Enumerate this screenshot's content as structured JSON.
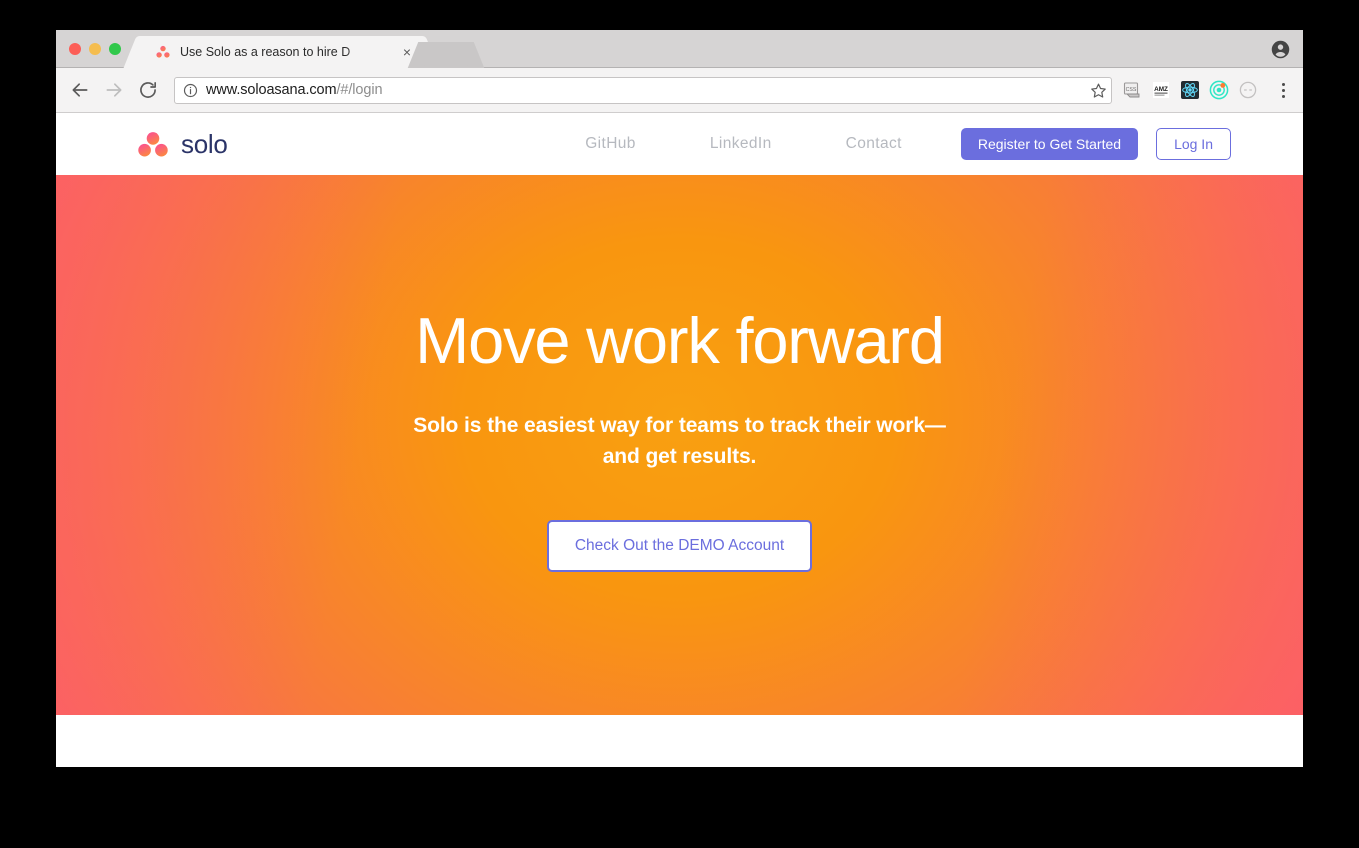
{
  "browser": {
    "tab": {
      "title": "Use Solo as a reason to hire D",
      "favicon": "solo-logo-icon",
      "close_label": "×"
    },
    "new_tab_label": "",
    "profile_icon": "account-avatar-icon",
    "toolbar": {
      "back_icon": "←",
      "forward_icon": "→",
      "reload_icon": "⟳",
      "security_icon": "info-circle-icon",
      "url_host": "www.soloasana.com",
      "url_path": "/#/login",
      "bookmark_icon": "star-icon",
      "menu_icon": "three-dot-menu-icon",
      "extensions": [
        {
          "name": "css-extension-icon",
          "label": "CSS"
        },
        {
          "name": "amz-extension-icon",
          "label": "AMZ"
        },
        {
          "name": "react-devtools-icon",
          "label": "React"
        },
        {
          "name": "teal-target-extension-icon",
          "label": ""
        },
        {
          "name": "disabled-extension-icon",
          "label": ""
        }
      ]
    },
    "window_controls": {
      "close": "close-window-button",
      "minimize": "minimize-window-button",
      "maximize": "maximize-window-button"
    }
  },
  "site": {
    "brand": {
      "name": "solo",
      "mark": "solo-three-dot-logo"
    },
    "nav": [
      {
        "label": "GitHub",
        "name": "nav-link-github"
      },
      {
        "label": "LinkedIn",
        "name": "nav-link-linkedin"
      },
      {
        "label": "Contact",
        "name": "nav-link-contact"
      }
    ],
    "actions": {
      "register_label": "Register to Get Started",
      "login_label": "Log In"
    },
    "hero": {
      "title": "Move work forward",
      "subtitle_line1": "Solo is the easiest way for teams to track their work—",
      "subtitle_line2": "and get results.",
      "cta_label": "Check Out the DEMO Account"
    }
  },
  "colors": {
    "brand_purple": "#6b6ede",
    "brand_navy": "#2b3468",
    "hero_orange": "#f9a011",
    "hero_coral": "#fc5b68",
    "nav_gray": "#b6b9bf"
  }
}
